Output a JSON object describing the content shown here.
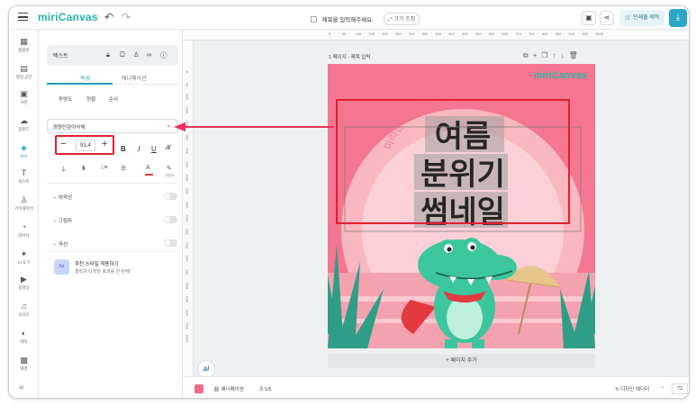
{
  "app": {
    "logo": "miriCanvas",
    "title_placeholder": "제목을 입력해주세요.",
    "size_chip": "크기 조정",
    "print_button": "인쇄물 제작"
  },
  "rail": {
    "items": [
      {
        "icon": "▦",
        "label": "템플릿"
      },
      {
        "icon": "▤",
        "label": "작업 공간"
      },
      {
        "icon": "▣",
        "label": "사진"
      },
      {
        "icon": "☁",
        "label": "업로드"
      },
      {
        "icon": "◈",
        "label": "요소"
      },
      {
        "icon": "T",
        "label": "텍스트"
      },
      {
        "icon": "♙",
        "label": "기어해이터"
      },
      {
        "icon": "◔",
        "label": "데이터"
      },
      {
        "icon": "✦",
        "label": "AI 도구"
      },
      {
        "icon": "▶",
        "label": "동영상"
      },
      {
        "icon": "♫",
        "label": "오디오"
      },
      {
        "icon": "◐",
        "label": "테마"
      },
      {
        "icon": "▩",
        "label": "배경"
      }
    ],
    "collapse": "«"
  },
  "panel": {
    "object_label": "텍스트",
    "tabs": [
      "속성",
      "애니메이션"
    ],
    "subtabs": [
      "투명도",
      "정렬",
      "순서"
    ],
    "font_name": "정원단감아삭체",
    "font_size": "91.4",
    "sections": [
      "외곽선",
      "그림자",
      "곡선"
    ],
    "recommend_icon": "Aa",
    "recommend_title": "추천 스타일 적용하기",
    "recommend_sub": "클릭과 다양한 효과를 한 번에!"
  },
  "workspace": {
    "ruler_ticks": [
      "0",
      "50",
      "100",
      "150",
      "200",
      "250",
      "300",
      "350",
      "400",
      "450",
      "500",
      "550",
      "600",
      "650",
      "700",
      "750",
      "800",
      "850",
      "900",
      "950",
      "1000"
    ],
    "ruler_left_ticks": [
      "0",
      "50",
      "100",
      "150",
      "200",
      "250",
      "300",
      "350",
      "400",
      "450",
      "500",
      "550",
      "600",
      "650",
      "700",
      "750",
      "800",
      "850",
      "900",
      "950",
      "1000"
    ],
    "page_label": "1 페이지 - 제목 입력",
    "add_page": "+ 페이지 추가",
    "ai_badge": "ai"
  },
  "design": {
    "brand": "miriCanvas",
    "arc_text": "미리캔버스 템플릿 활용하기",
    "headline_lines": [
      "여름",
      "분위기",
      "썸네일"
    ],
    "colors": {
      "background": "#f4768f",
      "sun": "#f9b7c0",
      "floor": "#f6a4b1",
      "leaf": "#2e9f86",
      "croc": "#3cc69e",
      "cape": "#e23a3f",
      "umbrella": "#e6c48a"
    }
  },
  "bottombar": {
    "animation": "애니메이션",
    "duration": "5초",
    "design_editor": "디자인 에디터",
    "zoom": "72"
  }
}
